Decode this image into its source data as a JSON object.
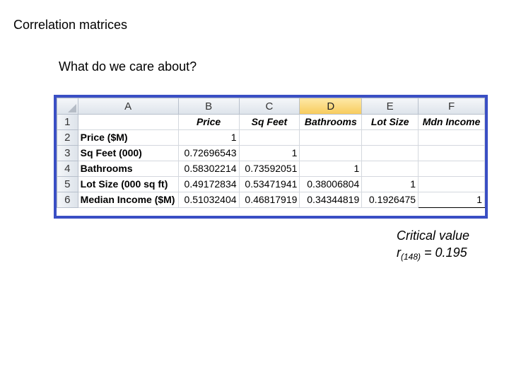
{
  "slide": {
    "title": "Correlation matrices",
    "subtitle": "What do we care about?"
  },
  "spreadsheet": {
    "column_letters": [
      "A",
      "B",
      "C",
      "D",
      "E",
      "F"
    ],
    "selected_column": "D",
    "row_numbers": [
      "1",
      "2",
      "3",
      "4",
      "5",
      "6"
    ],
    "header_row": [
      "",
      "Price",
      "Sq Feet",
      "Bathrooms",
      "Lot Size",
      "Mdn Income"
    ],
    "rows": [
      {
        "label": "Price ($M)",
        "values": [
          "1",
          "",
          "",
          "",
          ""
        ]
      },
      {
        "label": "Sq Feet (000)",
        "values": [
          "0.72696543",
          "1",
          "",
          "",
          ""
        ]
      },
      {
        "label": "Bathrooms",
        "values": [
          "0.58302214",
          "0.73592051",
          "1",
          "",
          ""
        ]
      },
      {
        "label": "Lot Size (000 sq ft)",
        "values": [
          "0.49172834",
          "0.53471941",
          "0.38006804",
          "1",
          ""
        ]
      },
      {
        "label": "Median Income ($M)",
        "values": [
          "0.51032404",
          "0.46817919",
          "0.34344819",
          "0.1926475",
          "1"
        ]
      }
    ]
  },
  "critical_value": {
    "line1": "Critical value",
    "r_symbol": "r",
    "df": "(148)",
    "equals": "= 0.195"
  },
  "colors": {
    "frame_border": "#3a4fc4",
    "selected_column_header": "#f7cb5c"
  }
}
